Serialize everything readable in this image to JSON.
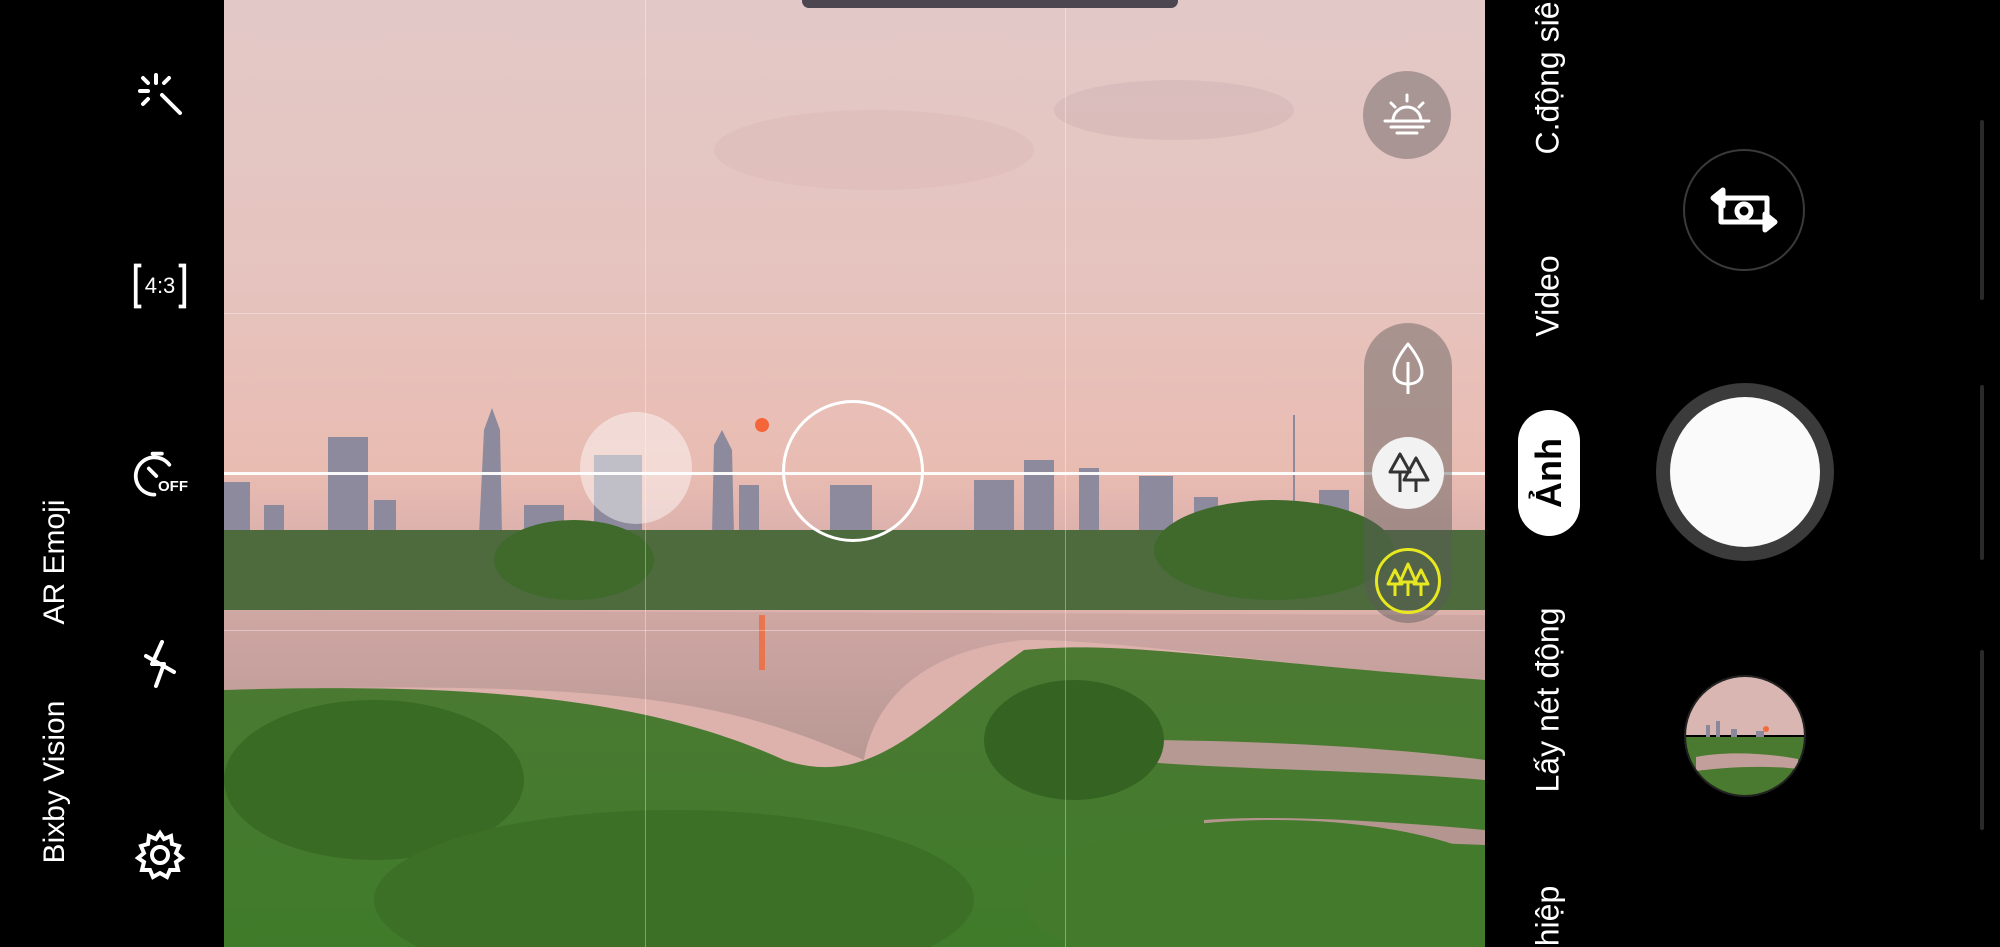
{
  "left_modes": [
    {
      "label": "Bixby Vision"
    },
    {
      "label": "AR Emoji"
    }
  ],
  "settings_bar": {
    "aspect_ratio_label": "4:3",
    "timer_label": "OFF",
    "icons": [
      "magic-wand-icon",
      "aspect-ratio-icon",
      "timer-off-icon",
      "flash-off-icon",
      "settings-gear-icon"
    ]
  },
  "viewfinder": {
    "scene_optimizer_icon": "sunrise-icon",
    "zoom_options": [
      "single-tree-icon",
      "two-trees-icon",
      "three-trees-icon"
    ],
    "selected_zoom_index": 2,
    "accent_color": "#e8e820"
  },
  "right_modes": [
    {
      "label": "C.động siê"
    },
    {
      "label": "Video"
    },
    {
      "label": "Ảnh",
      "selected": true
    },
    {
      "label": "Lấy nét động"
    },
    {
      "label": "hiệp"
    }
  ],
  "controls": {
    "switch_camera_icon": "switch-camera-icon",
    "shutter": "shutter-button",
    "gallery": "gallery-thumbnail"
  }
}
